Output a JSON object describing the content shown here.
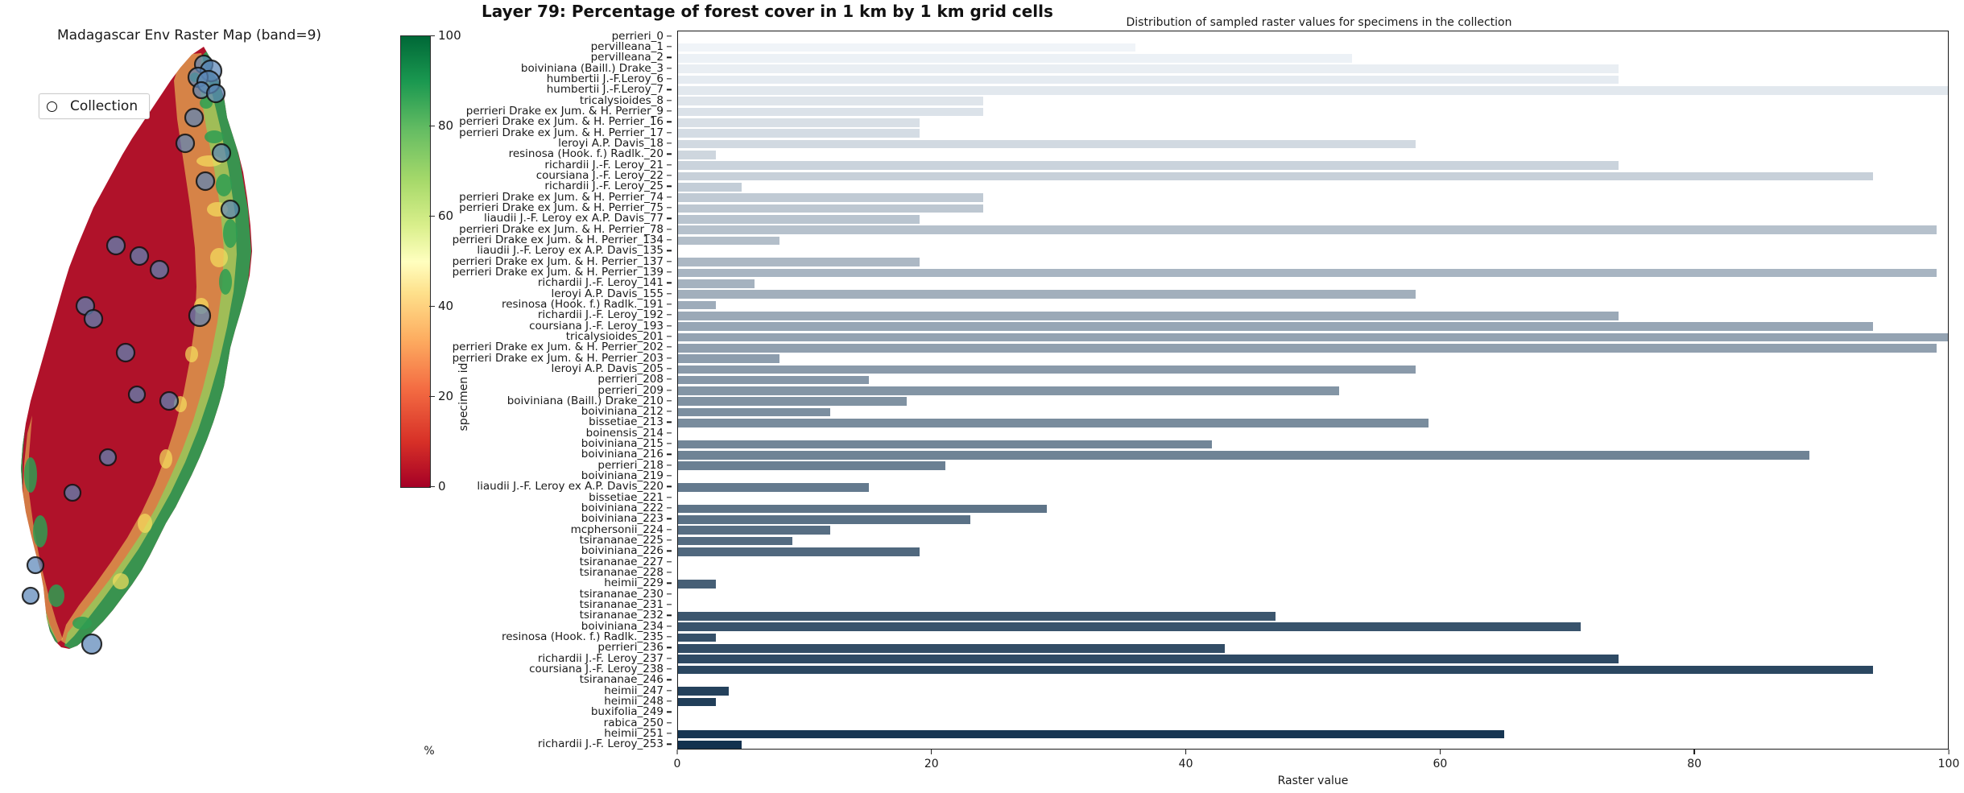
{
  "map": {
    "title": "Madagascar Env Raster Map (band=9)",
    "legend_label": "Collection",
    "legend_marker_icon": "circle-marker-icon"
  },
  "colorbar": {
    "unit_label": "%",
    "ticks": [
      0,
      20,
      40,
      60,
      80,
      100
    ],
    "vmin": 0,
    "vmax": 100,
    "colormap": "RdYlGn",
    "low_color": "#a50026",
    "mid_color": "#ffffbf",
    "high_color": "#006837"
  },
  "chart": {
    "title": "Layer 79: Percentage of forest cover in 1 km by 1 km grid cells",
    "subtitle": "Distribution of sampled raster values for specimens in the collection"
  },
  "chart_data": {
    "type": "bar",
    "orientation": "horizontal",
    "title": "Layer 79: Percentage of forest cover in 1 km by 1 km grid cells",
    "subtitle": "Distribution of sampled raster values for specimens in the collection",
    "xlabel": "Raster value",
    "ylabel": "specimen id",
    "xlim": [
      0,
      100
    ],
    "xticks": [
      0,
      20,
      40,
      60,
      80,
      100
    ],
    "grid": false,
    "legend": "none",
    "bar_color_low": "#f3f7fb",
    "bar_color_high": "#13324f",
    "categories": [
      "perrieri_0",
      "pervilleana_1",
      "pervilleana_2",
      "boiviniana (Baill.) Drake_3",
      "humbertii J.-F.Leroy_6",
      "humbertii J.-F.Leroy_7",
      "tricalysioides_8",
      "perrieri Drake ex Jum. & H. Perrier_9",
      "perrieri Drake ex Jum. & H. Perrier_16",
      "perrieri Drake ex Jum. & H. Perrier_17",
      "leroyi A.P. Davis_18",
      "resinosa (Hook. f.) Radlk._20",
      "richardii J.-F. Leroy_21",
      "coursiana J.-F. Leroy_22",
      "richardii J.-F. Leroy_25",
      "perrieri Drake ex Jum. & H. Perrier_74",
      "perrieri Drake ex Jum. & H. Perrier_75",
      "liaudii J.-F. Leroy ex A.P. Davis_77",
      "perrieri Drake ex Jum. & H. Perrier_78",
      "perrieri Drake ex Jum. & H. Perrier_134",
      "liaudii J.-F. Leroy ex A.P. Davis_135",
      "perrieri Drake ex Jum. & H. Perrier_137",
      "perrieri Drake ex Jum. & H. Perrier_139",
      "richardii J.-F. Leroy_141",
      "leroyi A.P. Davis_155",
      "resinosa (Hook. f.) Radlk._191",
      "richardii J.-F. Leroy_192",
      "coursiana J.-F. Leroy_193",
      "tricalysioides_201",
      "perrieri Drake ex Jum. & H. Perrier_202",
      "perrieri Drake ex Jum. & H. Perrier_203",
      "leroyi A.P. Davis_205",
      "perrieri_208",
      "perrieri_209",
      "boiviniana (Baill.) Drake_210",
      "boiviniana_212",
      "bissetiae_213",
      "boinensis_214",
      "boiviniana_215",
      "boiviniana_216",
      "perrieri_218",
      "boiviniana_219",
      "liaudii J.-F. Leroy ex A.P. Davis_220",
      "bissetiae_221",
      "boiviniana_222",
      "boiviniana_223",
      "mcphersonii_224",
      "tsirananae_225",
      "boiviniana_226",
      "tsirananae_227",
      "tsirananae_228",
      "heimii_229",
      "tsirananae_230",
      "tsirananae_231",
      "tsirananae_232",
      "boiviniana_234",
      "resinosa (Hook. f.) Radlk._235",
      "perrieri_236",
      "richardii J.-F. Leroy_237",
      "coursiana J.-F. Leroy_238",
      "tsirananae_246",
      "heimii_247",
      "heimii_248",
      "buxifolia_249",
      "rabica_250",
      "heimii_251",
      "richardii J.-F. Leroy_253"
    ],
    "values": [
      0,
      36,
      53,
      74,
      74,
      100,
      24,
      24,
      19,
      19,
      58,
      3,
      74,
      94,
      5,
      24,
      24,
      19,
      99,
      8,
      0,
      19,
      99,
      6,
      58,
      3,
      74,
      94,
      100,
      99,
      8,
      58,
      15,
      52,
      18,
      12,
      59,
      0,
      42,
      89,
      21,
      0,
      15,
      0,
      29,
      23,
      12,
      9,
      19,
      0,
      0,
      3,
      0,
      0,
      47,
      71,
      3,
      43,
      74,
      94,
      0,
      4,
      3,
      0,
      0,
      65,
      5
    ]
  }
}
